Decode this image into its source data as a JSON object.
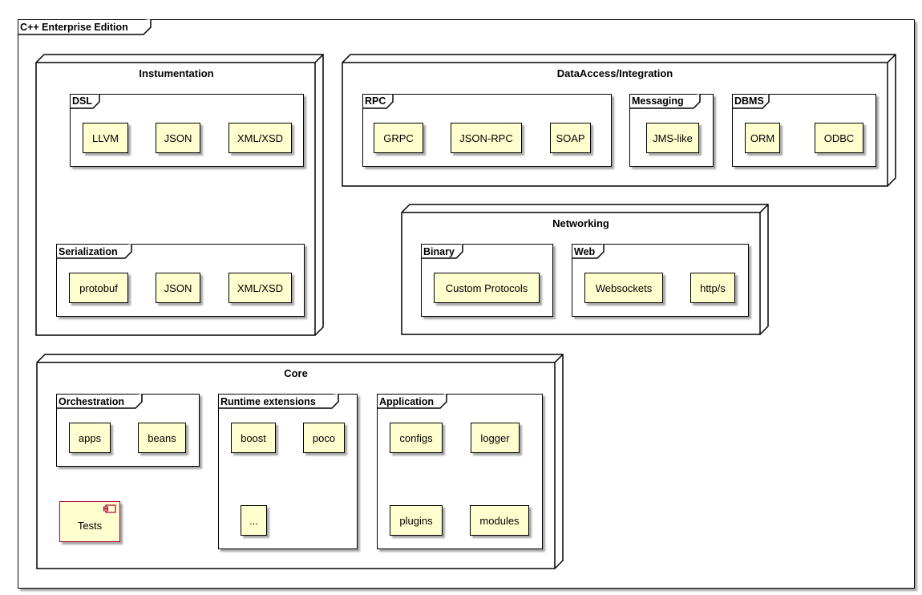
{
  "diagram": {
    "title": "C++ Enterprise Edition",
    "nodes": {
      "instrumentation": {
        "title": "Instumentation",
        "dsl": {
          "title": "DSL",
          "items": [
            "LLVM",
            "JSON",
            "XML/XSD"
          ]
        },
        "serialization": {
          "title": "Serialization",
          "items": [
            "protobuf",
            "JSON",
            "XML/XSD"
          ]
        }
      },
      "data_access": {
        "title": "DataAccess/Integration",
        "rpc": {
          "title": "RPC",
          "items": [
            "GRPC",
            "JSON-RPC",
            "SOAP"
          ]
        },
        "messaging": {
          "title": "Messaging",
          "items": [
            "JMS-like"
          ]
        },
        "dbms": {
          "title": "DBMS",
          "items": [
            "ORM",
            "ODBC"
          ]
        }
      },
      "networking": {
        "title": "Networking",
        "binary": {
          "title": "Binary",
          "items": [
            "Custom Protocols"
          ]
        },
        "web": {
          "title": "Web",
          "items": [
            "Websockets",
            "http/s"
          ]
        }
      },
      "core": {
        "title": "Core",
        "orchestration": {
          "title": "Orchestration",
          "items": [
            "apps",
            "beans"
          ]
        },
        "runtime_extensions": {
          "title": "Runtime extensions",
          "items": [
            "boost",
            "poco",
            "..."
          ]
        },
        "application": {
          "title": "Application",
          "items": [
            "configs",
            "logger",
            "plugins",
            "modules"
          ]
        },
        "tests_component": "Tests"
      }
    },
    "colors": {
      "artifact_fill": "#FEFECE",
      "component_border": "#A80036",
      "line": "#000000"
    }
  }
}
